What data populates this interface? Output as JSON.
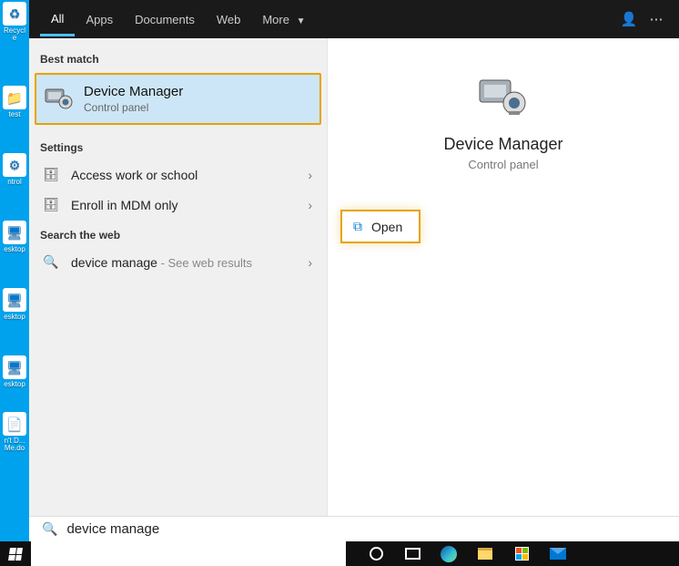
{
  "desktop_icons": [
    {
      "label": "Recycle"
    },
    {
      "label": "test"
    },
    {
      "label": "ntrol"
    },
    {
      "label": "esktop"
    },
    {
      "label": "esktop"
    },
    {
      "label": "esktop"
    },
    {
      "label": "n't D... Me.do"
    }
  ],
  "tabs": {
    "items": [
      "All",
      "Apps",
      "Documents",
      "Web",
      "More"
    ],
    "active_index": 0
  },
  "sections": {
    "best_match": "Best match",
    "settings": "Settings",
    "search_web": "Search the web"
  },
  "best_match": {
    "title": "Device Manager",
    "subtitle": "Control panel"
  },
  "settings_rows": [
    {
      "label": "Access work or school"
    },
    {
      "label": "Enroll in MDM only"
    }
  ],
  "web_row": {
    "query": "device manage",
    "hint": " - See web results"
  },
  "detail": {
    "title": "Device Manager",
    "subtitle": "Control panel",
    "open_label": "Open"
  },
  "search_value": "device manage",
  "highlight_color": "#e6a400",
  "accent_color": "#0078d4"
}
